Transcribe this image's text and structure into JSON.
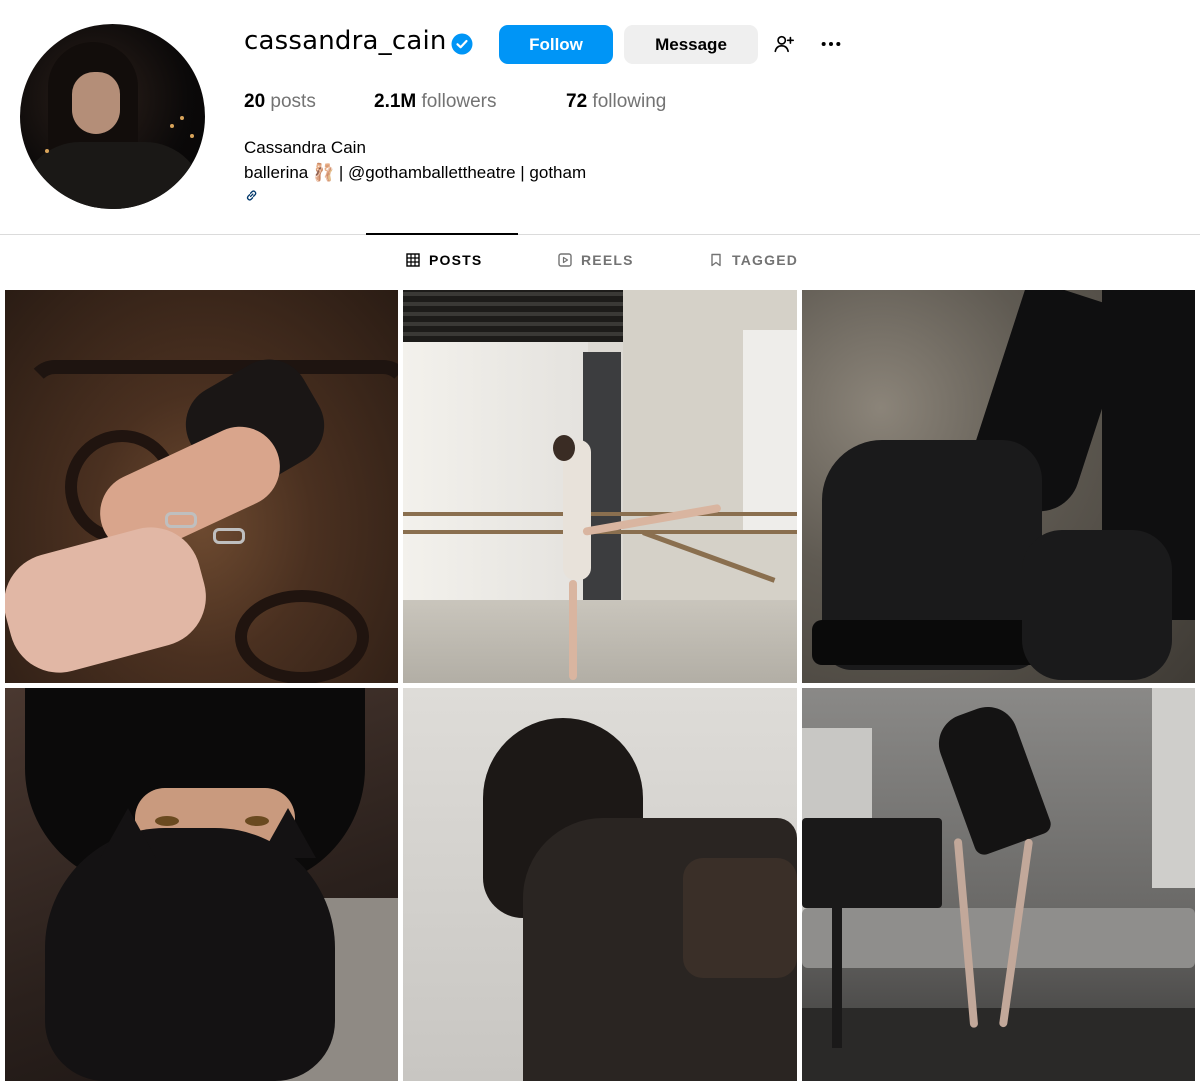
{
  "profile": {
    "username": "cassandra_cain",
    "full_name": "Cassandra Cain",
    "bio": "ballerina 🩰 | @gothamballettheatre | gotham",
    "verified": true
  },
  "actions": {
    "follow_label": "Follow",
    "message_label": "Message"
  },
  "stats": {
    "posts_count": "20",
    "posts_label": "posts",
    "followers_count": "2.1M",
    "followers_label": "followers",
    "following_count": "72",
    "following_label": "following"
  },
  "tabs": [
    {
      "label": "POSTS",
      "icon": "grid-icon",
      "active": true
    },
    {
      "label": "REELS",
      "icon": "reels-icon",
      "active": false
    },
    {
      "label": "TAGGED",
      "icon": "tag-icon",
      "active": false
    }
  ],
  "colors": {
    "primary_button": "#0095f6",
    "secondary_button": "#efefef",
    "verified_badge": "#0095f6",
    "muted_text": "#737373"
  },
  "grid": [
    {
      "alt": "hands with rings"
    },
    {
      "alt": "ballet barre stretch"
    },
    {
      "alt": "black boots on rocks"
    },
    {
      "alt": "black cat portrait"
    },
    {
      "alt": "dark hair jacket"
    },
    {
      "alt": "ballerina by piano"
    }
  ]
}
